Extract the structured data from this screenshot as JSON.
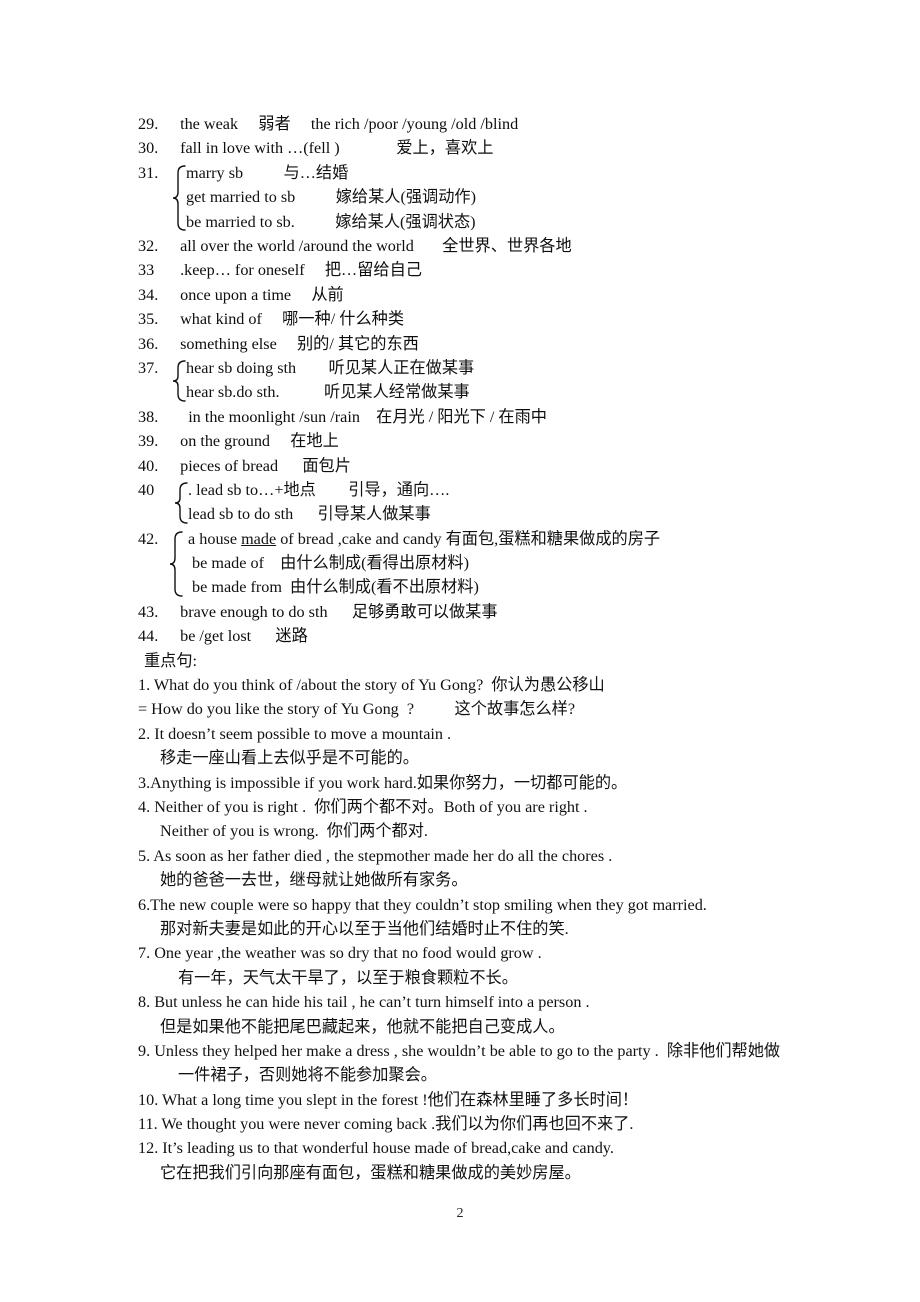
{
  "document": {
    "page_number": "2",
    "phrases_heading": "",
    "key_sentences_heading": "重点句:"
  },
  "phrases": [
    {
      "kind": "simple",
      "number": "29.",
      "text": "  the weak     弱者     the rich /poor /young /old /blind"
    },
    {
      "kind": "simple",
      "number": "30.",
      "text": "  fall in love with …(fell )              爱上，喜欢上"
    },
    {
      "kind": "brace",
      "number": "31.",
      "rows": [
        "marry sb          与…结婚",
        "get married to sb          嫁给某人(强调动作)",
        "be married to sb.          嫁给某人(强调状态)"
      ]
    },
    {
      "kind": "simple",
      "number": "32.",
      "text": "  all over the world /around the world       全世界、世界各地"
    },
    {
      "kind": "simple",
      "number": "33",
      "text": "  .keep… for oneself     把…留给自己"
    },
    {
      "kind": "simple",
      "number": "34.",
      "text": "  once upon a time     从前"
    },
    {
      "kind": "simple",
      "number": "35.",
      "text": "  what kind of     哪一种/ 什么种类"
    },
    {
      "kind": "simple",
      "number": "36.",
      "text": "  something else     别的/ 其它的东西"
    },
    {
      "kind": "brace",
      "number": "37.",
      "rows": [
        "hear sb doing sth        听见某人正在做某事",
        "hear sb.do sth.           听见某人经常做某事"
      ]
    },
    {
      "kind": "simple",
      "number": "38.",
      "text": "    in the moonlight /sun /rain    在月光 / 阳光下 / 在雨中"
    },
    {
      "kind": "simple",
      "number": "39.",
      "text": "  on the ground     在地上"
    },
    {
      "kind": "simple",
      "number": "40.",
      "text": "  pieces of bread      面包片"
    },
    {
      "kind": "brace",
      "number": "40",
      "rows": [
        ". lead sb to…+地点        引导，通向….",
        "lead sb to do sth      引导某人做某事"
      ]
    },
    {
      "kind": "brace-underline",
      "number": "42.",
      "rows": [
        {
          "pre": " a house ",
          "ul": "made",
          "post": " of bread ,cake and candy 有面包,蛋糕和糖果做成的房子"
        },
        {
          "pre": " be made of    由什么制成(看得出原材料)",
          "ul": "",
          "post": ""
        },
        {
          "pre": " be made from  由什么制成(看不出原材料)",
          "ul": "",
          "post": ""
        }
      ]
    },
    {
      "kind": "simple",
      "number": "43.",
      "text": "  brave enough to do sth      足够勇敢可以做某事"
    },
    {
      "kind": "simple",
      "number": "44.",
      "text": "  be /get lost      迷路"
    }
  ],
  "key_sentences": [
    {
      "indent": 0,
      "text": "1. What do you think of /about the story of Yu Gong?  你认为愚公移山"
    },
    {
      "indent": 0,
      "text": "= How do you like the story of Yu Gong  ?          这个故事怎么样?"
    },
    {
      "indent": 0,
      "text": "2. It doesn’t seem possible to move a mountain ."
    },
    {
      "indent": 1,
      "text": "移走一座山看上去似乎是不可能的。"
    },
    {
      "indent": 0,
      "text": "3.Anything is impossible if you work hard.如果你努力，一切都可能的。"
    },
    {
      "indent": 0,
      "text": "4. Neither of you is right .  你们两个都不对。Both of you are right ."
    },
    {
      "indent": 1,
      "text": "Neither of you is wrong.  你们两个都对."
    },
    {
      "indent": 0,
      "text": "5. As soon as her father died , the stepmother made her do all the chores ."
    },
    {
      "indent": 1,
      "text": "她的爸爸一去世，继母就让她做所有家务。"
    },
    {
      "indent": 0,
      "text": "6.The new couple were so happy that they couldn’t stop smiling when they got married."
    },
    {
      "indent": 1,
      "text": "那对新夫妻是如此的开心以至于当他们结婚时止不住的笑."
    },
    {
      "indent": 0,
      "text": "7. One year ,the weather was so dry that no food would grow ."
    },
    {
      "indent": 2,
      "text": "有一年，天气太干旱了，以至于粮食颗粒不长。"
    },
    {
      "indent": 0,
      "text": "8. But unless he can hide his tail , he can’t turn himself into a person ."
    },
    {
      "indent": 1,
      "text": "但是如果他不能把尾巴藏起来，他就不能把自己变成人。"
    },
    {
      "indent": 0,
      "text": "9. Unless they helped her make a dress , she wouldn’t be able to go to the party .  除非他们帮她做"
    },
    {
      "indent": 2,
      "text": "一件裙子，否则她将不能参加聚会。"
    },
    {
      "indent": 0,
      "text": "10. What a long time you slept in the forest !他们在森林里睡了多长时间！"
    },
    {
      "indent": 0,
      "text": "11. We thought you were never coming back .我们以为你们再也回不来了."
    },
    {
      "indent": 0,
      "text": "12. It’s leading us to that wonderful house made of bread,cake and candy."
    },
    {
      "indent": 1,
      "text": "它在把我们引向那座有面包，蛋糕和糖果做成的美妙房屋。"
    }
  ]
}
